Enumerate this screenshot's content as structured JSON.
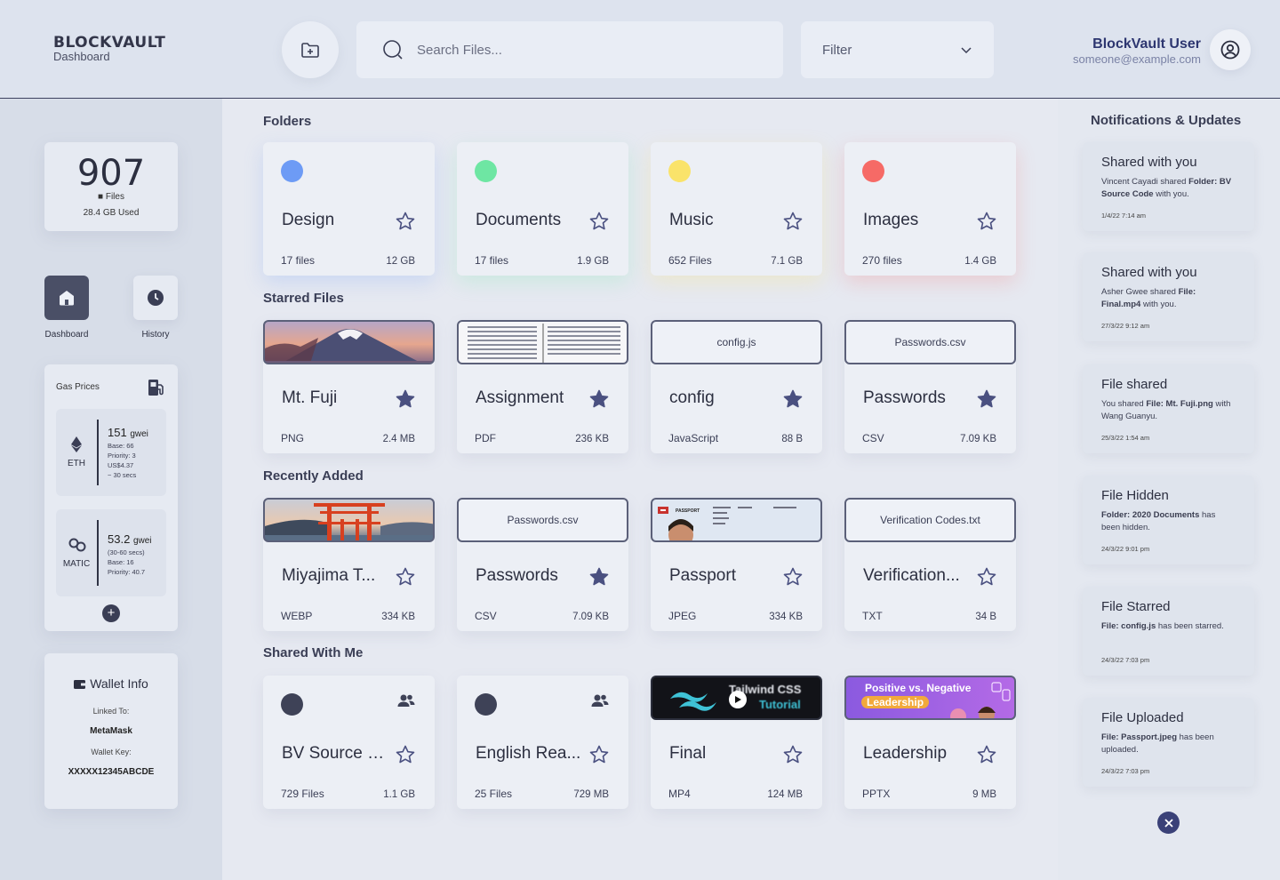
{
  "header": {
    "logo_title": "BLOCKVAULT",
    "logo_sub": "Dashboard",
    "search_placeholder": "Search Files...",
    "filter_label": "Filter",
    "user_name": "BlockVault User",
    "user_email": "someone@example.com"
  },
  "left": {
    "file_count": "907",
    "files_label": "Files",
    "used": "28.4 GB Used",
    "nav": [
      {
        "label": "Dashboard"
      },
      {
        "label": "History"
      }
    ],
    "gas_title": "Gas Prices",
    "eth": {
      "coin": "ETH",
      "value": "151",
      "unit": "gwei",
      "lines": [
        "Base: 66",
        "Priority: 3",
        "US$4.37",
        "~ 30 secs"
      ]
    },
    "matic": {
      "coin": "MATIC",
      "value": "53.2",
      "unit": "gwei",
      "lines": [
        "(30-60 secs)",
        "Base: 16",
        "Priority: 40.7"
      ]
    },
    "wallet_title": "Wallet Info",
    "linked_label": "Linked To:",
    "linked_value": "MetaMask",
    "key_label": "Wallet Key:",
    "key_value": "XXXXX12345ABCDE"
  },
  "sections": {
    "folders": "Folders",
    "starred": "Starred Files",
    "recent": "Recently Added",
    "shared": "Shared With Me"
  },
  "folders": [
    {
      "title": "Design",
      "left": "17 files",
      "right": "12 GB",
      "color": "#6d9bf5"
    },
    {
      "title": "Documents",
      "left": "17 files",
      "right": "1.9 GB",
      "color": "#6ee6a3"
    },
    {
      "title": "Music",
      "left": "652 Files",
      "right": "7.1 GB",
      "color": "#fae36a"
    },
    {
      "title": "Images",
      "left": "270 files",
      "right": "1.4 GB",
      "color": "#f66a66"
    }
  ],
  "starred": [
    {
      "title": "Mt. Fuji",
      "left": "PNG",
      "right": "2.4 MB"
    },
    {
      "title": "Assignment",
      "left": "PDF",
      "right": "236 KB"
    },
    {
      "title": "config",
      "left": "JavaScript",
      "right": "88 B",
      "thumb": "config.js"
    },
    {
      "title": "Passwords",
      "left": "CSV",
      "right": "7.09 KB",
      "thumb": "Passwords.csv"
    }
  ],
  "recent": [
    {
      "title": "Miyajima T...",
      "left": "WEBP",
      "right": "334 KB"
    },
    {
      "title": "Passwords",
      "left": "CSV",
      "right": "7.09 KB",
      "thumb": "Passwords.csv"
    },
    {
      "title": "Passport",
      "left": "JPEG",
      "right": "334 KB"
    },
    {
      "title": "Verification...",
      "left": "TXT",
      "right": "34 B",
      "thumb": "Verification Codes.txt"
    }
  ],
  "shared": [
    {
      "title": "BV Source C...",
      "left": "729 Files",
      "right": "1.1 GB"
    },
    {
      "title": "English Rea...",
      "left": "25 Files",
      "right": "729 MB"
    },
    {
      "title": "Final",
      "left": "MP4",
      "right": "124 MB"
    },
    {
      "title": "Leadership",
      "left": "PPTX",
      "right": "9 MB"
    }
  ],
  "thumb_text": {
    "tailwind": "Tailwind CSS",
    "tailwind2": "Tutorial",
    "leader1": "Positive vs. Negative",
    "leader2": "Leadership",
    "passport": "PASSPORT"
  },
  "notifications_title": "Notifications & Updates",
  "notifications": [
    {
      "title": "Shared with you",
      "pre": "Vincent Cayadi shared ",
      "b1": "Folder:",
      "mid": " ",
      "b2": "BV Source Code",
      "post": " with you.",
      "time": "1/4/22 7:14 am"
    },
    {
      "title": "Shared with you",
      "pre": "Asher Gwee shared ",
      "b1": "File:",
      "mid": " ",
      "b2": "Final.mp4",
      "post": " with you.",
      "time": "27/3/22 9:12 am"
    },
    {
      "title": "File shared",
      "pre": "You shared ",
      "b1": "File:",
      "mid": " ",
      "b2": "Mt. Fuji.png",
      "post": " with Wang Guanyu.",
      "time": "25/3/22 1:54 am"
    },
    {
      "title": "File Hidden",
      "pre": "",
      "b1": "Folder:",
      "mid": " ",
      "b2": "2020 Documents",
      "post": " has been hidden.",
      "time": "24/3/22 9:01 pm"
    },
    {
      "title": "File Starred",
      "pre": "",
      "b1": "File:",
      "mid": " ",
      "b2": "config.js",
      "post": " has been starred.",
      "time": "24/3/22 7:03 pm"
    },
    {
      "title": "File Uploaded",
      "pre": "",
      "b1": "File:",
      "mid": " ",
      "b2": "Passport.jpeg",
      "post": " has been uploaded.",
      "time": "24/3/22 7:03 pm"
    }
  ]
}
